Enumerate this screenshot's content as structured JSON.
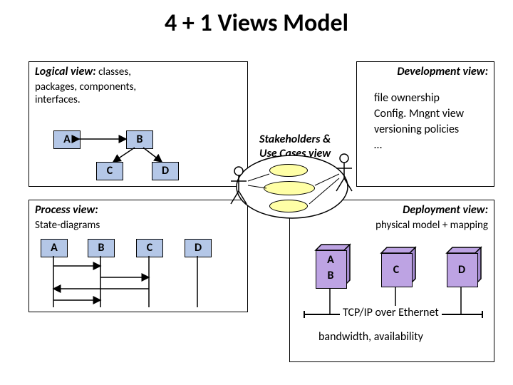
{
  "title": "4 + 1 Views Model",
  "center": {
    "title_line1": "Stakeholders &",
    "title_line2": "Use Cases view"
  },
  "logical": {
    "title": "Logical view:",
    "desc1": "classes,",
    "desc2": "packages, components, interfaces.",
    "nodes": {
      "A": "A",
      "B": "B",
      "C": "C",
      "D": "D"
    }
  },
  "development": {
    "title": "Development view:",
    "items": [
      "file ownership",
      "Config. Mngnt view",
      "versioning policies",
      "…"
    ]
  },
  "process": {
    "title": "Process view:",
    "subtitle": "State-diagrams",
    "lanes": {
      "A": "A",
      "B": "B",
      "C": "C",
      "D": "D"
    }
  },
  "deployment": {
    "title": "Deployment view:",
    "subtitle": "physical model + mapping",
    "blocks": {
      "A": "A",
      "B": "B",
      "C": "C",
      "D": "D"
    },
    "bus_label": "TCP/IP over Ethernet",
    "footer": "bandwidth, availability"
  }
}
